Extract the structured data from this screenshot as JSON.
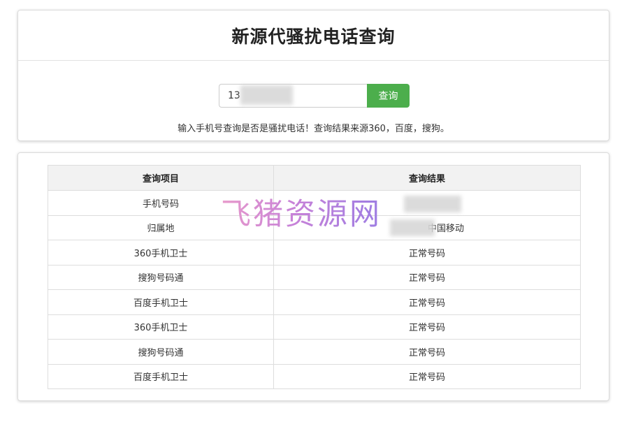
{
  "header": {
    "title": "新源代骚扰电话查询"
  },
  "search": {
    "value": "13",
    "button_label": "查询"
  },
  "hint": "输入手机号查询是否是骚扰电话！查询结果来源360，百度，搜狗。",
  "table": {
    "headers": [
      "查询项目",
      "查询结果"
    ],
    "rows": [
      [
        "手机号码",
        ""
      ],
      [
        "归属地",
        "中国移动"
      ],
      [
        "360手机卫士",
        "正常号码"
      ],
      [
        "搜狗号码通",
        "正常号码"
      ],
      [
        "百度手机卫士",
        "正常号码"
      ],
      [
        "360手机卫士",
        "正常号码"
      ],
      [
        "搜狗号码通",
        "正常号码"
      ],
      [
        "百度手机卫士",
        "正常号码"
      ]
    ]
  },
  "watermark": "飞猪资源网"
}
